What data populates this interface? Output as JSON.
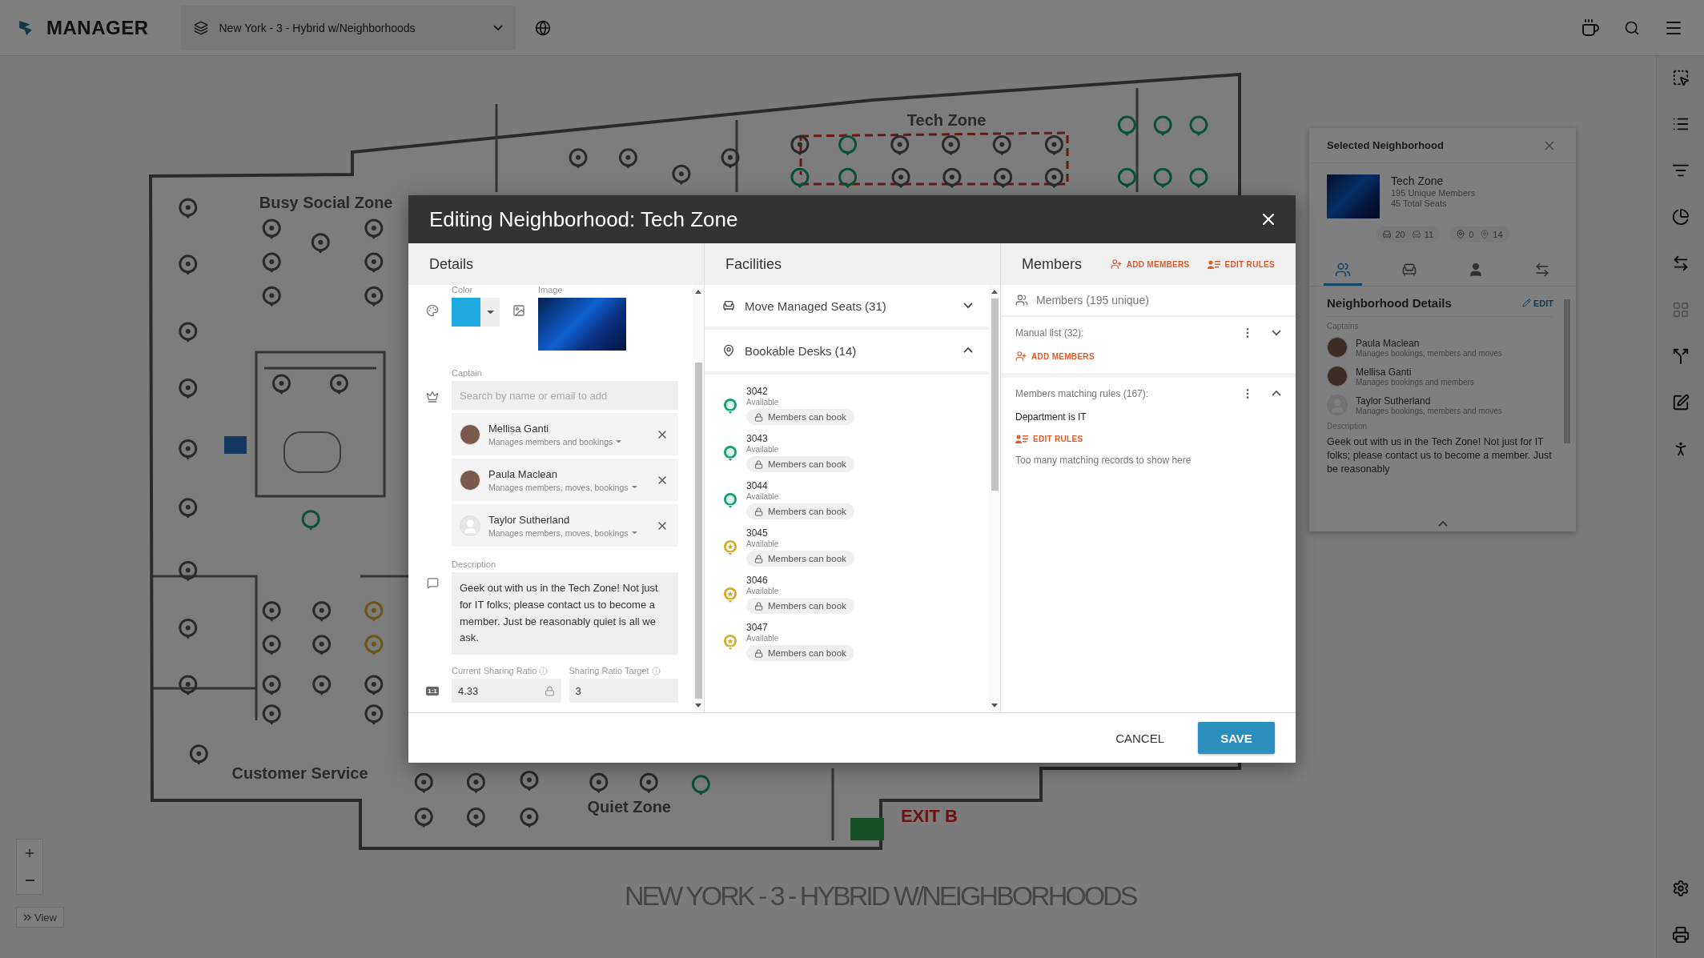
{
  "app": {
    "logo": "MANAGER",
    "location": "New York - 3 - Hybrid w/Neighborhoods"
  },
  "map": {
    "zones": [
      {
        "label": "Busy Social Zone",
        "kind": "zone"
      },
      {
        "label": "Tech Zone",
        "kind": "zone"
      },
      {
        "label": "Customer Service",
        "kind": "zone"
      },
      {
        "label": "Quiet Zone",
        "kind": "zone"
      },
      {
        "label": "EXIT B",
        "kind": "exit"
      }
    ],
    "floor_title": "NEW YORK - 3 - HYBRID W/NEIGHBORHOODS",
    "view_button": "View"
  },
  "selected_panel": {
    "title": "Selected Neighborhood",
    "name": "Tech Zone",
    "members": "195 Unique Members",
    "seats": "45 Total Seats",
    "stats": [
      {
        "kind": "seat",
        "value": "20"
      },
      {
        "kind": "seat-outline",
        "value": "11"
      },
      {
        "kind": "pin",
        "value": "0"
      },
      {
        "kind": "pin-outline",
        "value": "14"
      }
    ],
    "tabs": [
      {
        "kind": "members",
        "selected": true
      },
      {
        "kind": "seat",
        "selected": false
      },
      {
        "kind": "person",
        "selected": false
      },
      {
        "kind": "moves",
        "selected": false
      }
    ],
    "section_title": "Neighborhood Details",
    "edit": "EDIT",
    "captains_label": "Captains",
    "captains": [
      {
        "name": "Paula Maclean",
        "role": "Manages bookings, members and moves",
        "has_photo": true
      },
      {
        "name": "Mellisa Ganti",
        "role": "Manages bookings and members",
        "has_photo": true
      },
      {
        "name": "Taylor Sutherland",
        "role": "Manages bookings, members and moves",
        "has_photo": false
      }
    ],
    "description_label": "Description",
    "description": "Geek out with us in the Tech Zone! Not just for IT folks; please contact us to become a member. Just be reasonably"
  },
  "modal": {
    "title": "Editing Neighborhood: Tech Zone",
    "details": {
      "heading": "Details",
      "color_label": "Color",
      "color": "#1fa8e0",
      "image_label": "Image",
      "captain_label": "Captain",
      "captain_placeholder": "Search by name or email to add",
      "captains": [
        {
          "name": "Mellisa Ganti",
          "role": "Manages members and bookings",
          "has_photo": true
        },
        {
          "name": "Paula Maclean",
          "role": "Manages members, moves, bookings",
          "has_photo": true
        },
        {
          "name": "Taylor Sutherland",
          "role": "Manages members, moves, bookings",
          "has_photo": false
        }
      ],
      "description_label": "Description",
      "description": "Geek out with us in the Tech Zone! Not just for IT folks; please contact us to become a member. Just be reasonably quiet is all we ask.",
      "ratio_badge": "1:1",
      "current_ratio_label": "Current Sharing Ratio",
      "current_ratio": "4.33",
      "target_label": "Sharing Ratio Target",
      "target": "3"
    },
    "facilities": {
      "heading": "Facilities",
      "groups": [
        {
          "label": "Move Managed Seats (31)",
          "kind": "seats",
          "expanded": false
        },
        {
          "label": "Bookable Desks (14)",
          "kind": "desks",
          "expanded": true,
          "desks": [
            {
              "number": "3042",
              "status": "Available",
              "policy": "Members can book",
              "kind": "plain",
              "color": "#16a074"
            },
            {
              "number": "3043",
              "status": "Available",
              "policy": "Members can book",
              "kind": "plain",
              "color": "#16a074"
            },
            {
              "number": "3044",
              "status": "Available",
              "policy": "Members can book",
              "kind": "plain",
              "color": "#16a074"
            },
            {
              "number": "3045",
              "status": "Available",
              "policy": "Members can book",
              "kind": "star",
              "color": "#d6ad2b"
            },
            {
              "number": "3046",
              "status": "Available",
              "policy": "Members can book",
              "kind": "star",
              "color": "#d6ad2b"
            },
            {
              "number": "3047",
              "status": "Available",
              "policy": "Members can book",
              "kind": "star",
              "color": "#d6ad2b"
            }
          ]
        }
      ]
    },
    "members": {
      "heading": "Members",
      "actions": [
        {
          "kind": "add",
          "label": "ADD MEMBERS"
        },
        {
          "kind": "rules",
          "label": "EDIT RULES"
        }
      ],
      "summary": "Members (195 unique)",
      "manual": {
        "label": "Manual list (32):",
        "expanded": false,
        "action": "ADD MEMBERS"
      },
      "rules": {
        "label": "Members matching rules (167):",
        "expanded": true,
        "rule": "Department is IT",
        "action": "EDIT RULES",
        "note": "Too many matching records to show here"
      }
    },
    "cancel": "CANCEL",
    "save": "SAVE"
  }
}
